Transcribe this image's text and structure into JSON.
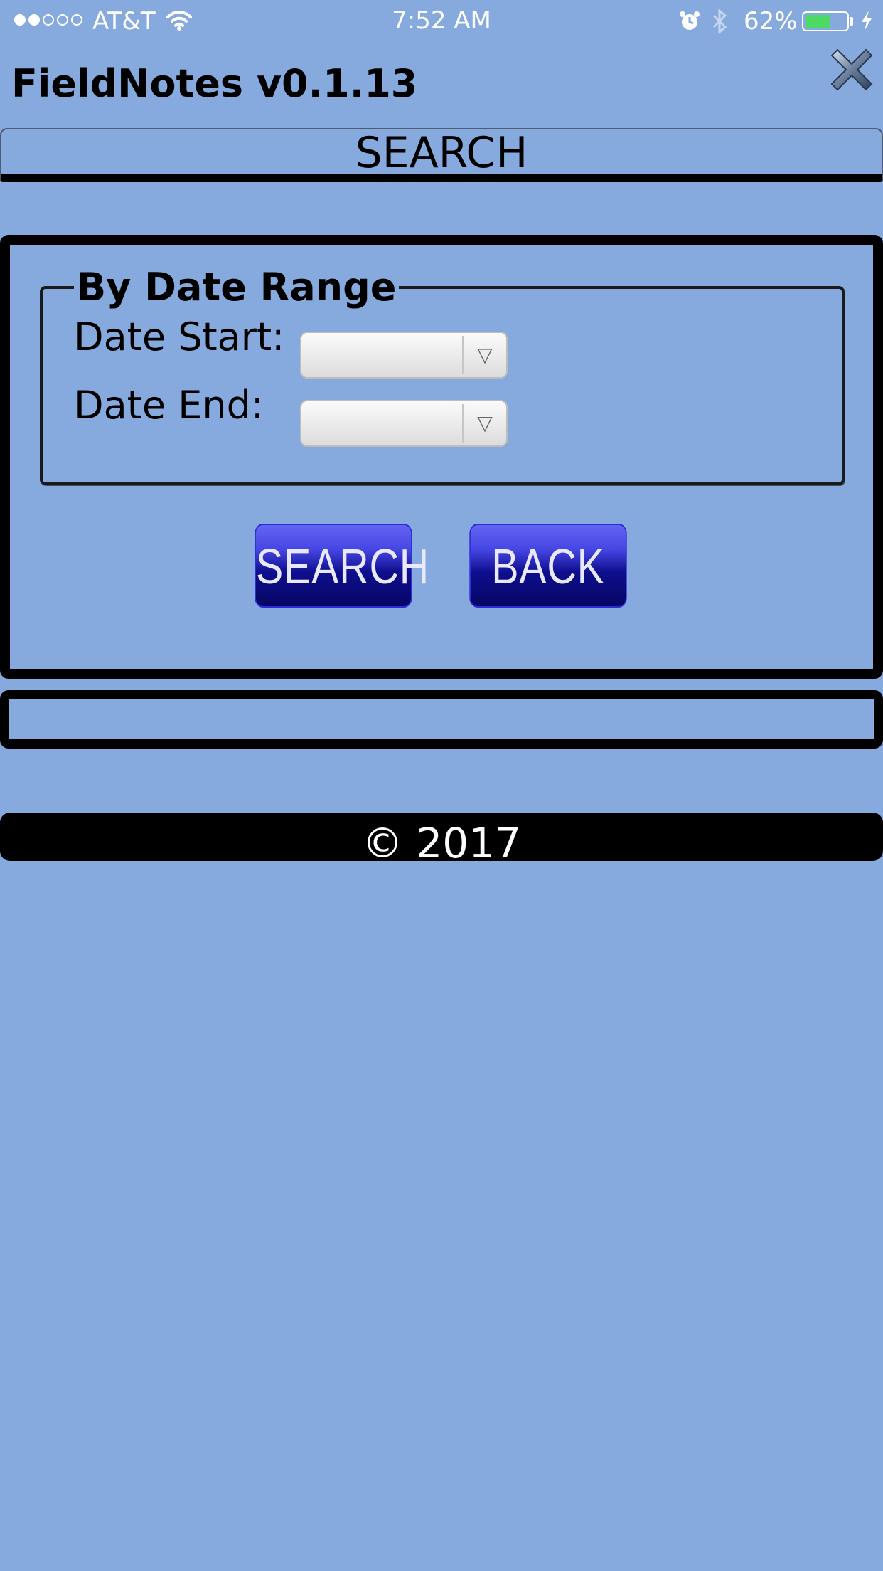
{
  "status_bar": {
    "carrier": "AT&T",
    "time": "7:52 AM",
    "battery_percent": "62%",
    "battery_level": 0.62,
    "signal_bars_filled": 2,
    "signal_bars_total": 5,
    "icons": [
      "wifi-icon",
      "alarm-icon",
      "bluetooth-icon",
      "battery-icon",
      "charging-bolt-icon"
    ]
  },
  "header": {
    "app_title": "FieldNotes v0.1.13",
    "close_icon": "close-x-icon"
  },
  "section": {
    "title": "SEARCH"
  },
  "date_range": {
    "legend": "By Date Range",
    "start_label": "Date Start:",
    "start_value": "",
    "end_label": "Date End:",
    "end_value": "",
    "dropdown_arrow": "▽"
  },
  "buttons": {
    "search_label": "SEARCH",
    "back_label": "BACK"
  },
  "footer": {
    "copyright": "© 2017"
  },
  "colors": {
    "background": "#86a9de",
    "button_top": "#6464f2",
    "button_bottom": "#060664",
    "battery_fill": "#4cd964"
  }
}
